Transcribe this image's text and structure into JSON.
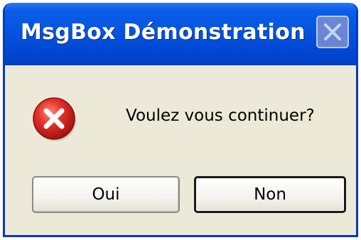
{
  "window": {
    "title": "MsgBox Démonstration"
  },
  "dialog": {
    "icon": "error-icon",
    "message": "Voulez vous continuer?"
  },
  "buttons": {
    "yes_label": "Oui",
    "no_label": "Non"
  },
  "colors": {
    "titlebar": "#0054e3",
    "dialog_bg": "#ece9d8",
    "error_red": "#e0312d"
  }
}
